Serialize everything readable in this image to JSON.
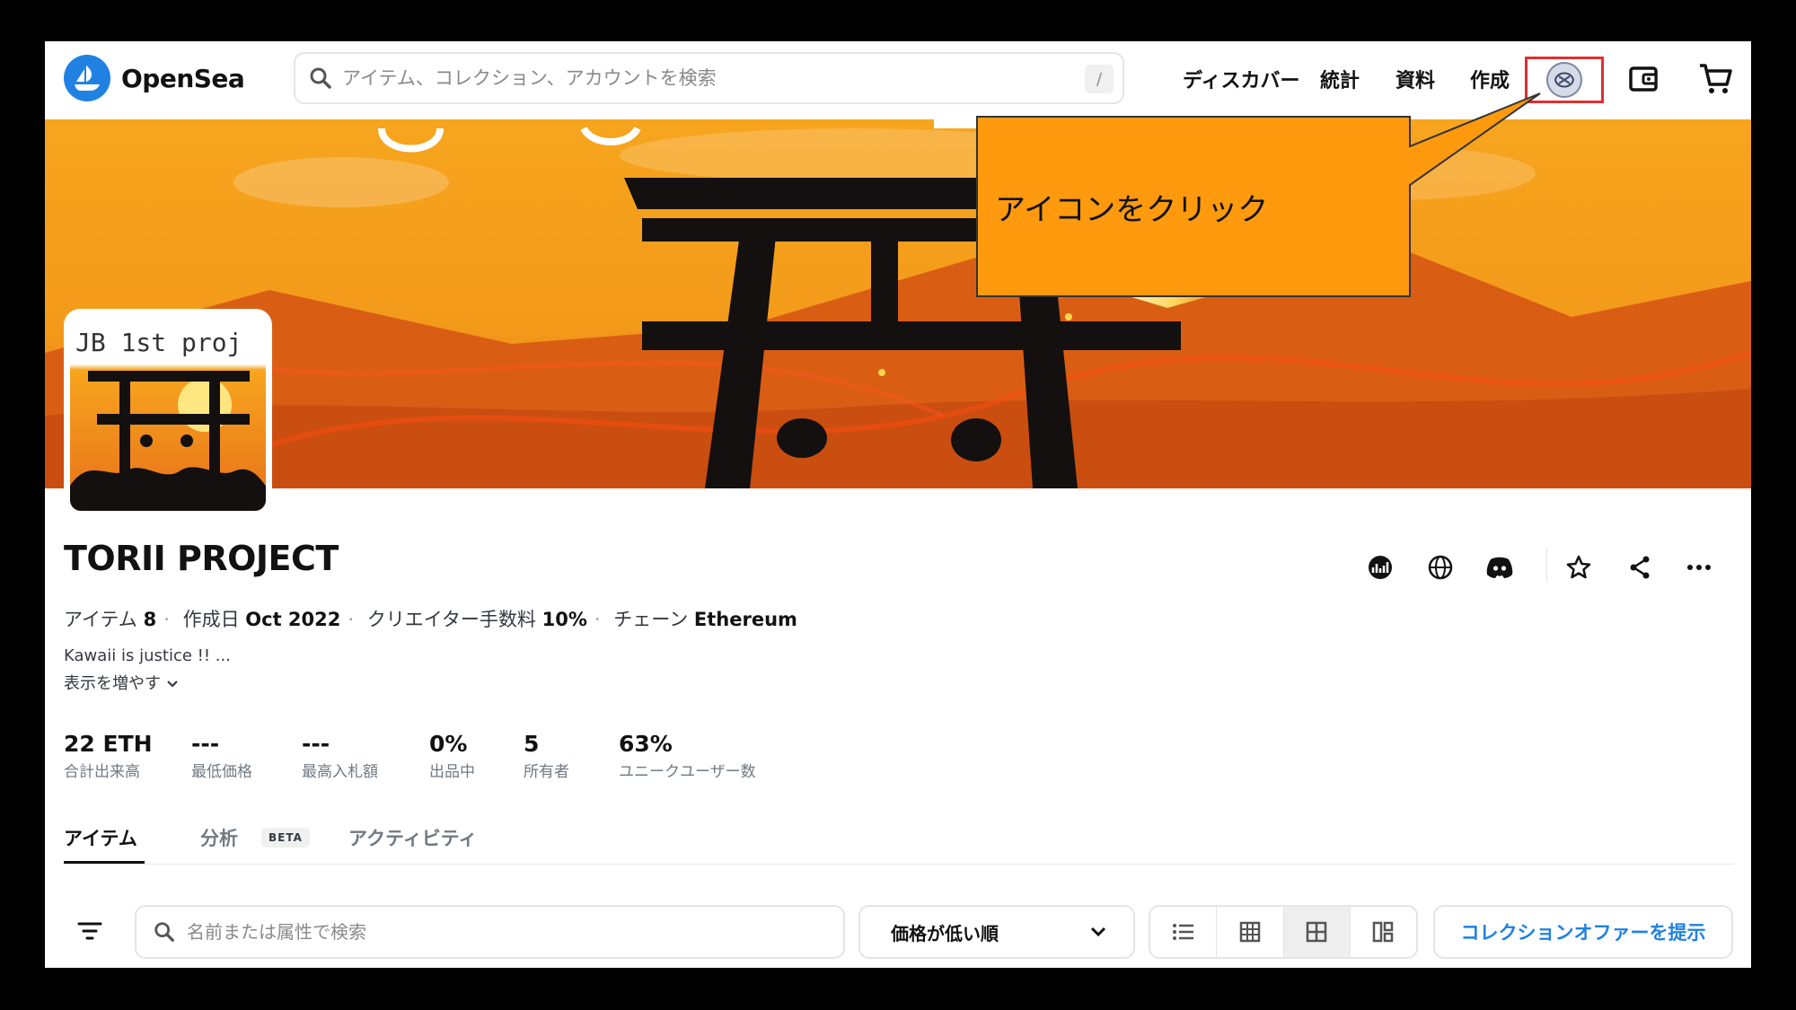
{
  "header": {
    "logo_text": "OpenSea",
    "search_placeholder": "アイテム、コレクション、アカウントを検索",
    "search_shortcut": "/",
    "nav": [
      "ディスカバー",
      "統計",
      "資料",
      "作成"
    ]
  },
  "callout": {
    "text": "アイコンをクリック"
  },
  "collection": {
    "image_text": "JB 1st proj",
    "title": "TORII PROJECT",
    "meta": {
      "items_label": "アイテム",
      "items_value": "8",
      "created_label": "作成日",
      "created_value": "Oct 2022",
      "fee_label": "クリエイター手数料",
      "fee_value": "10%",
      "chain_label": "チェーン",
      "chain_value": "Ethereum"
    },
    "description": "Kawaii is justice !! ...",
    "show_more": "表示を増やす"
  },
  "stats": [
    {
      "value": "22 ETH",
      "label": "合計出来高"
    },
    {
      "value": "---",
      "label": "最低価格"
    },
    {
      "value": "---",
      "label": "最高入札額"
    },
    {
      "value": "0%",
      "label": "出品中"
    },
    {
      "value": "5",
      "label": "所有者"
    },
    {
      "value": "63%",
      "label": "ユニークユーザー数"
    }
  ],
  "tabs": {
    "items": "アイテム",
    "analytics": "分析",
    "beta": "BETA",
    "activity": "アクティビティ"
  },
  "toolbar": {
    "search_placeholder": "名前または属性で検索",
    "sort_label": "価格が低い順",
    "offer_label": "コレクションオファーを提示"
  },
  "colors": {
    "brand": "#2081e2",
    "callout_fill": "#ff9a0e",
    "highlight": "#e03030"
  }
}
